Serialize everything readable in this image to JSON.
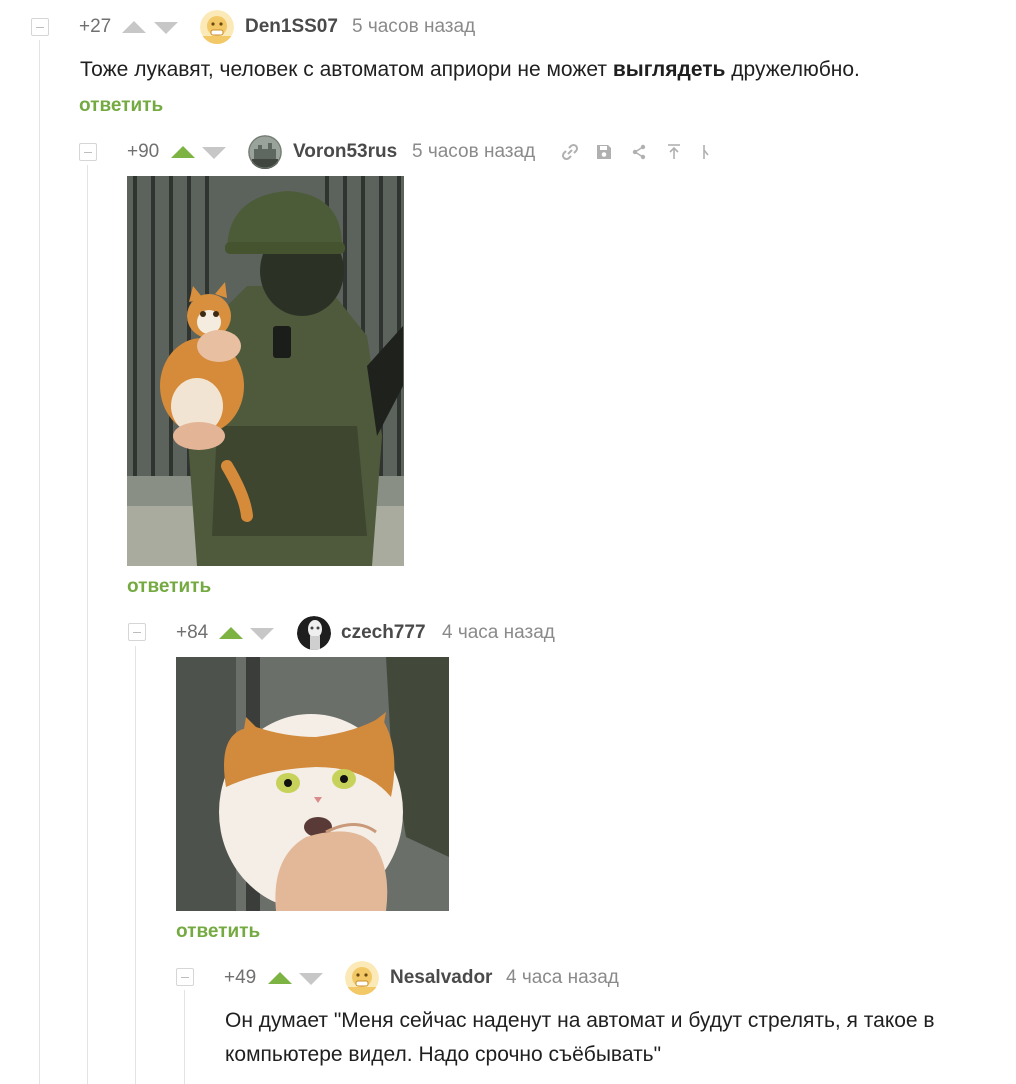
{
  "colors": {
    "accent_green": "#74aa41",
    "upvote_active": "#7cb342",
    "vote_inactive": "#c7c7c7",
    "meta_gray": "#8a8a8a"
  },
  "comments": [
    {
      "rating": "+27",
      "upvoted": false,
      "username": "Den1SS07",
      "avatar_icon": "default-avatar-icon",
      "time": "5 часов назад",
      "text_before": "Тоже лукавят, человек с автоматом априори не может ",
      "text_bold": "выглядеть",
      "text_after": " дружелюбно.",
      "reply_label": "ответить"
    },
    {
      "rating": "+90",
      "upvoted": true,
      "username": "Voron53rus",
      "avatar_icon": "user-avatar-icon",
      "time": "5 часов назад",
      "tools": [
        "link-icon",
        "save-icon",
        "share-icon",
        "scroll-up-icon",
        "more-icon"
      ],
      "image_icon": "soldier-holding-cat-image",
      "reply_label": "ответить"
    },
    {
      "rating": "+84",
      "upvoted": true,
      "username": "czech777",
      "avatar_icon": "user-avatar-icon",
      "time": "4 часа назад",
      "image_icon": "scared-cat-closeup-image",
      "reply_label": "ответить"
    },
    {
      "rating": "+49",
      "upvoted": true,
      "username": "Nesalvador",
      "avatar_icon": "default-avatar-icon",
      "time": "4 часа назад",
      "text": "Он думает \"Меня сейчас наденут на автомат и будут стрелять, я такое в компьютере видел. Надо срочно съёбывать\""
    }
  ]
}
